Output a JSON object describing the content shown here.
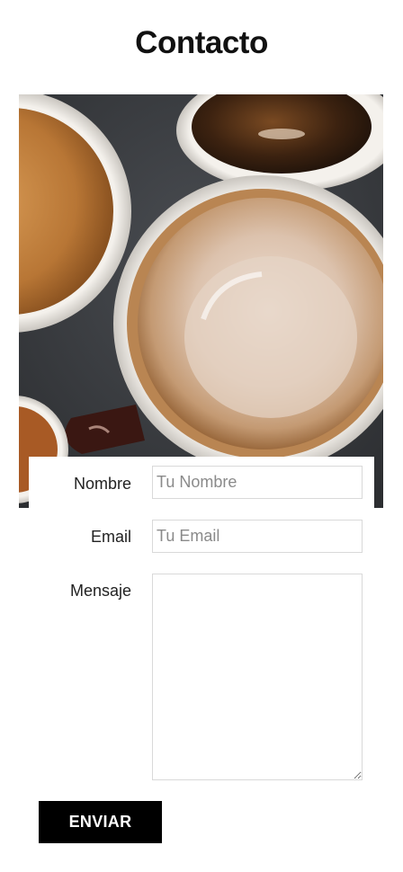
{
  "header": {
    "title": "Contacto"
  },
  "hero": {
    "icon": "coffee-cups-photo"
  },
  "form": {
    "name": {
      "label": "Nombre",
      "placeholder": "Tu Nombre",
      "value": ""
    },
    "email": {
      "label": "Email",
      "placeholder": "Tu Email",
      "value": ""
    },
    "message": {
      "label": "Mensaje",
      "value": ""
    },
    "submit_label": "ENVIAR"
  },
  "colors": {
    "button_bg": "#000000",
    "button_text": "#ffffff",
    "input_border": "#d9d9d9",
    "title": "#111111"
  }
}
